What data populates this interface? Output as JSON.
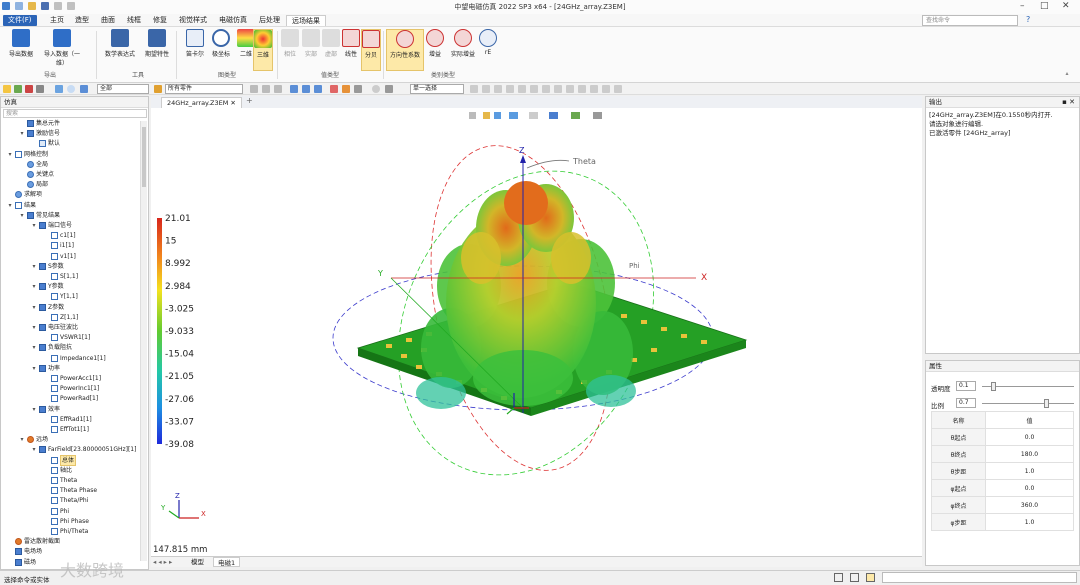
{
  "app": {
    "title": "中望电磁仿真 2022 SP3 x64 - [24GHz_array.Z3EM]",
    "search_placeholder": "查找命令"
  },
  "menus": [
    "文件(F)",
    "主页",
    "造型",
    "曲面",
    "线框",
    "修复",
    "视觉样式",
    "电磁仿真",
    "后处理",
    "远场结果"
  ],
  "ribbon": {
    "buttons": [
      {
        "label": "导出数据"
      },
      {
        "label": "导入数据（一维）"
      },
      {
        "label": "数学表达式"
      },
      {
        "label": "期望特性"
      },
      {
        "label": "笛卡尔"
      },
      {
        "label": "极坐标"
      },
      {
        "label": "二维"
      },
      {
        "label": "三维"
      },
      {
        "label": "相位"
      },
      {
        "label": "实部"
      },
      {
        "label": "虚部"
      },
      {
        "label": "线性"
      },
      {
        "label": "分贝"
      },
      {
        "label": "方向性系数"
      },
      {
        "label": "增益"
      },
      {
        "label": "实际增益"
      },
      {
        "label": "rE"
      }
    ],
    "groups": [
      {
        "label": "导出"
      },
      {
        "label": "工具"
      },
      {
        "label": "图类型"
      },
      {
        "label": "值类型"
      },
      {
        "label": "类别类型"
      }
    ]
  },
  "toolbar": {
    "filter_all": "全部",
    "parts": "所有零件",
    "select_mode": "单一选择"
  },
  "sim_panel": {
    "title": "仿真",
    "search_placeholder": "搜索"
  },
  "tree": [
    {
      "label": "集总元件",
      "lvl": 1,
      "ex": "",
      "ic": "blue"
    },
    {
      "label": "激励信号",
      "lvl": 1,
      "ex": "▾",
      "ic": "blue"
    },
    {
      "label": "默认",
      "lvl": 2,
      "ex": "",
      "ic": ""
    },
    {
      "label": "网格控制",
      "lvl": 0,
      "ex": "▾",
      "ic": "grid"
    },
    {
      "label": "全局",
      "lvl": 1,
      "ex": "",
      "ic": "globe"
    },
    {
      "label": "关键点",
      "lvl": 1,
      "ex": "",
      "ic": "globe"
    },
    {
      "label": "局部",
      "lvl": 1,
      "ex": "",
      "ic": "globe"
    },
    {
      "label": "求解项",
      "lvl": 0,
      "ex": "",
      "ic": "globe"
    },
    {
      "label": "结果",
      "lvl": 0,
      "ex": "▾",
      "ic": "grid"
    },
    {
      "label": "常见结果",
      "lvl": 1,
      "ex": "▾",
      "ic": "blue"
    },
    {
      "label": "端口信号",
      "lvl": 2,
      "ex": "▾",
      "ic": "blue"
    },
    {
      "label": "c1[1]",
      "lvl": 3,
      "ex": "",
      "ic": "grid"
    },
    {
      "label": "i1[1]",
      "lvl": 3,
      "ex": "",
      "ic": "grid"
    },
    {
      "label": "v1[1]",
      "lvl": 3,
      "ex": "",
      "ic": "grid"
    },
    {
      "label": "S参数",
      "lvl": 2,
      "ex": "▾",
      "ic": "blue"
    },
    {
      "label": "S[1,1]",
      "lvl": 3,
      "ex": "",
      "ic": "grid"
    },
    {
      "label": "Y参数",
      "lvl": 2,
      "ex": "▾",
      "ic": "blue"
    },
    {
      "label": "Y[1,1]",
      "lvl": 3,
      "ex": "",
      "ic": "grid"
    },
    {
      "label": "Z参数",
      "lvl": 2,
      "ex": "▾",
      "ic": "blue"
    },
    {
      "label": "Z[1,1]",
      "lvl": 3,
      "ex": "",
      "ic": "grid"
    },
    {
      "label": "电压驻波比",
      "lvl": 2,
      "ex": "▾",
      "ic": "blue"
    },
    {
      "label": "VSWR1[1]",
      "lvl": 3,
      "ex": "",
      "ic": "grid"
    },
    {
      "label": "负载阻抗",
      "lvl": 2,
      "ex": "▾",
      "ic": "blue"
    },
    {
      "label": "Impedance1[1]",
      "lvl": 3,
      "ex": "",
      "ic": "grid"
    },
    {
      "label": "功率",
      "lvl": 2,
      "ex": "▾",
      "ic": "blue"
    },
    {
      "label": "PowerAcc1[1]",
      "lvl": 3,
      "ex": "",
      "ic": "grid"
    },
    {
      "label": "PowerInc1[1]",
      "lvl": 3,
      "ex": "",
      "ic": "grid"
    },
    {
      "label": "PowerRad[1]",
      "lvl": 3,
      "ex": "",
      "ic": "grid"
    },
    {
      "label": "效率",
      "lvl": 2,
      "ex": "▾",
      "ic": "blue"
    },
    {
      "label": "EffRad1[1]",
      "lvl": 3,
      "ex": "",
      "ic": "grid"
    },
    {
      "label": "EffTot1[1]",
      "lvl": 3,
      "ex": "",
      "ic": "grid"
    },
    {
      "label": "远场",
      "lvl": 1,
      "ex": "▾",
      "ic": "fire"
    },
    {
      "label": "FarField[23.80000051GHz][1]",
      "lvl": 2,
      "ex": "▾",
      "ic": "blue"
    },
    {
      "label": "总体",
      "lvl": 3,
      "ex": "",
      "ic": "grid",
      "sel": true
    },
    {
      "label": "轴比",
      "lvl": 3,
      "ex": "",
      "ic": "grid"
    },
    {
      "label": "Theta",
      "lvl": 3,
      "ex": "",
      "ic": "grid"
    },
    {
      "label": "Theta Phase",
      "lvl": 3,
      "ex": "",
      "ic": "grid"
    },
    {
      "label": "Theta/Phi",
      "lvl": 3,
      "ex": "",
      "ic": "grid"
    },
    {
      "label": "Phi",
      "lvl": 3,
      "ex": "",
      "ic": "grid"
    },
    {
      "label": "Phi Phase",
      "lvl": 3,
      "ex": "",
      "ic": "grid"
    },
    {
      "label": "Phi/Theta",
      "lvl": 3,
      "ex": "",
      "ic": "grid"
    },
    {
      "label": "雷达散射截面",
      "lvl": 0,
      "ex": "",
      "ic": "fire"
    },
    {
      "label": "电场场",
      "lvl": 0,
      "ex": "",
      "ic": "blue"
    },
    {
      "label": "磁场",
      "lvl": 0,
      "ex": "",
      "ic": "blue"
    }
  ],
  "doc_tab": "24GHz_array.Z3EM",
  "viewport": {
    "colorbar": [
      "21.01",
      "15",
      "8.992",
      "2.984",
      "-3.025",
      "-9.033",
      "-15.04",
      "-21.05",
      "-27.06",
      "-33.07",
      "-39.08"
    ],
    "axis_theta": "Theta",
    "axis_phi": "Phi",
    "axis_x": "X",
    "axis_y": "Y",
    "axis_z": "Z",
    "scale": "147.815 mm"
  },
  "bottom_tabs": [
    "模型",
    "电磁1"
  ],
  "output": {
    "title": "输出",
    "lines": [
      "[24GHz_array.Z3EM]在0.1550秒内打开.",
      "请选对象进行编辑.",
      "已激活零件 [24GHz_array]"
    ]
  },
  "props": {
    "title": "属性",
    "transparency_label": "透明度",
    "transparency_value": "0.1",
    "transparency_level": 0.1,
    "scale_label": "比例",
    "scale_value": "0.7",
    "scale_level": 0.7,
    "header_name": "名称",
    "header_value": "值",
    "rows": [
      {
        "k": "θ起点",
        "v": "0.0"
      },
      {
        "k": "θ终点",
        "v": "180.0"
      },
      {
        "k": "θ步距",
        "v": "1.0"
      },
      {
        "k": "φ起点",
        "v": "0.0"
      },
      {
        "k": "φ终点",
        "v": "360.0"
      },
      {
        "k": "φ步距",
        "v": "1.0"
      }
    ]
  },
  "status": {
    "text": "选择命令或实体"
  },
  "watermark": "大数跨境",
  "colors": {
    "accent": "#2b64b7",
    "selected": "#fde9a8"
  }
}
